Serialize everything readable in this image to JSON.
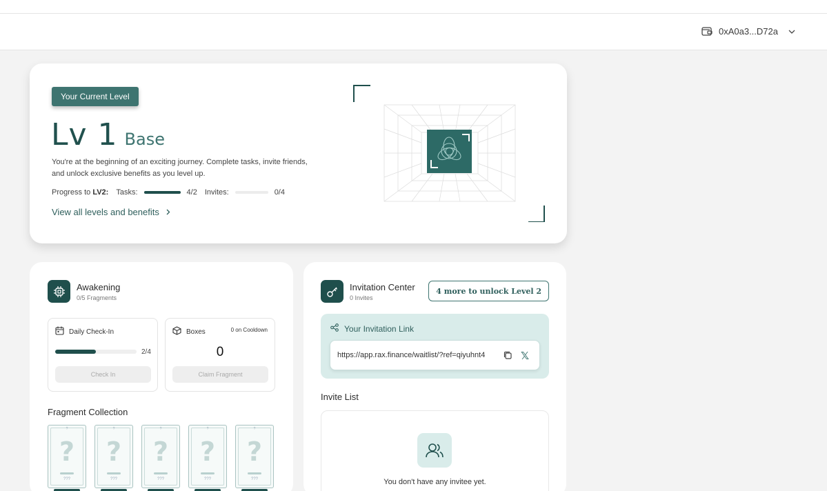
{
  "header": {
    "wallet_address": "0xA0a3...D72a"
  },
  "level": {
    "badge": "Your Current Level",
    "level_number": "Lv 1",
    "level_name": "Base",
    "description": "You're at the beginning of an exciting journey. Complete tasks, invite friends, and unlock exclusive benefits as you level up.",
    "progress_label_prefix": "Progress to",
    "progress_target": "LV2:",
    "tasks_label": "Tasks:",
    "tasks_value": "4/2",
    "tasks_progress": 1.0,
    "invites_label": "Invites:",
    "invites_value": "0/4",
    "invites_progress": 0.0,
    "view_link": "View all levels and benefits"
  },
  "awakening": {
    "title": "Awakening",
    "subtitle": "0/5 Fragments",
    "checkin": {
      "title": "Daily Check-In",
      "progress_value": "2/4",
      "progress": 0.5,
      "button": "Check In"
    },
    "boxes": {
      "title": "Boxes",
      "cooldown": "0 on Cooldown",
      "count": "0",
      "button": "Claim Fragment"
    },
    "fragments_title": "Fragment Collection",
    "fragments": [
      {
        "symbol": "?",
        "dots": "???"
      },
      {
        "symbol": "?",
        "dots": "???"
      },
      {
        "symbol": "?",
        "dots": "???"
      },
      {
        "symbol": "?",
        "dots": "???"
      },
      {
        "symbol": "?",
        "dots": "???"
      }
    ]
  },
  "invitation": {
    "title": "Invitation Center",
    "subtitle": "0 Invites",
    "unlock_button": "4 more to unlock Level 2",
    "link_label": "Your Invitation Link",
    "link_value": "https://app.rax.finance/waitlist/?ref=qiyuhnt4",
    "list_title": "Invite List",
    "empty_text": "You don't have any invitee yet."
  },
  "colors": {
    "accent_dark": "#1f4f4c",
    "accent": "#3e7470",
    "accent_light": "#d9ecea"
  }
}
